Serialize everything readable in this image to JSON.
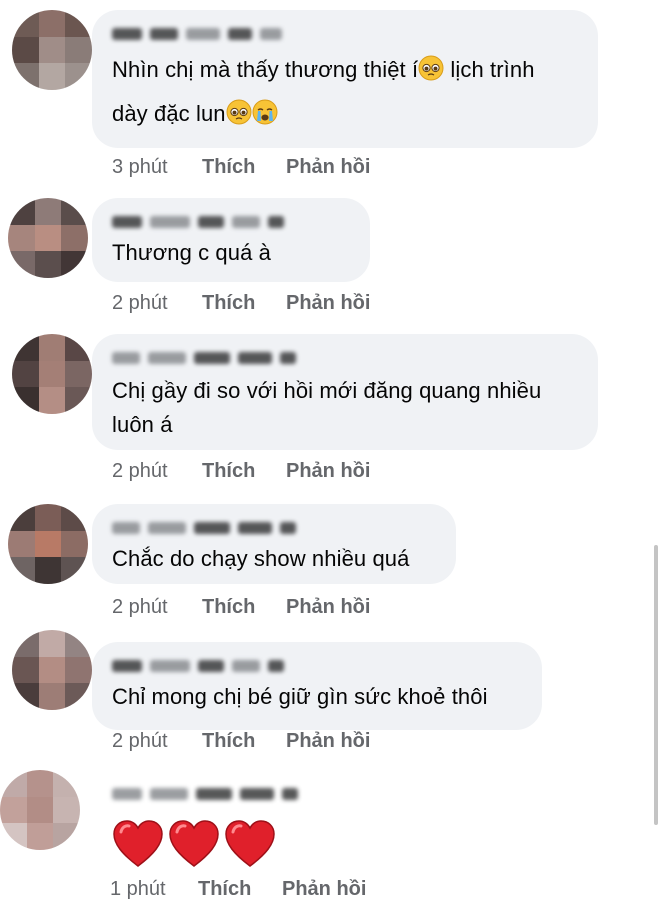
{
  "comments": [
    {
      "text": "Nhìn chị mà thấy thương thiệt í",
      "text2": " lịch trình",
      "text3": "dày đặc lun",
      "emojis": [
        "pleading-face",
        "pleading-face",
        "crying-face"
      ],
      "time": "3 phút",
      "like": "Thích",
      "reply": "Phản hồi"
    },
    {
      "text": "Thương c quá à",
      "time": "2 phút",
      "like": "Thích",
      "reply": "Phản hồi"
    },
    {
      "text": "Chị gầy đi so với hồi mới đăng quang nhiều",
      "text2": "luôn á",
      "time": "2 phút",
      "like": "Thích",
      "reply": "Phản hồi"
    },
    {
      "text": "Chắc do chạy show nhiều quá",
      "time": "2 phút",
      "like": "Thích",
      "reply": "Phản hồi"
    },
    {
      "text": "Chỉ mong chị bé giữ gìn sức khoẻ thôi",
      "time": "2 phút",
      "like": "Thích",
      "reply": "Phản hồi"
    },
    {
      "emojis": [
        "red-heart",
        "red-heart",
        "red-heart"
      ],
      "time": "1 phút",
      "like": "Thích",
      "reply": "Phản hồi"
    }
  ],
  "colors": {
    "bubble": "#f0f2f5",
    "meta": "#65676b",
    "heart": "#e0202b"
  }
}
